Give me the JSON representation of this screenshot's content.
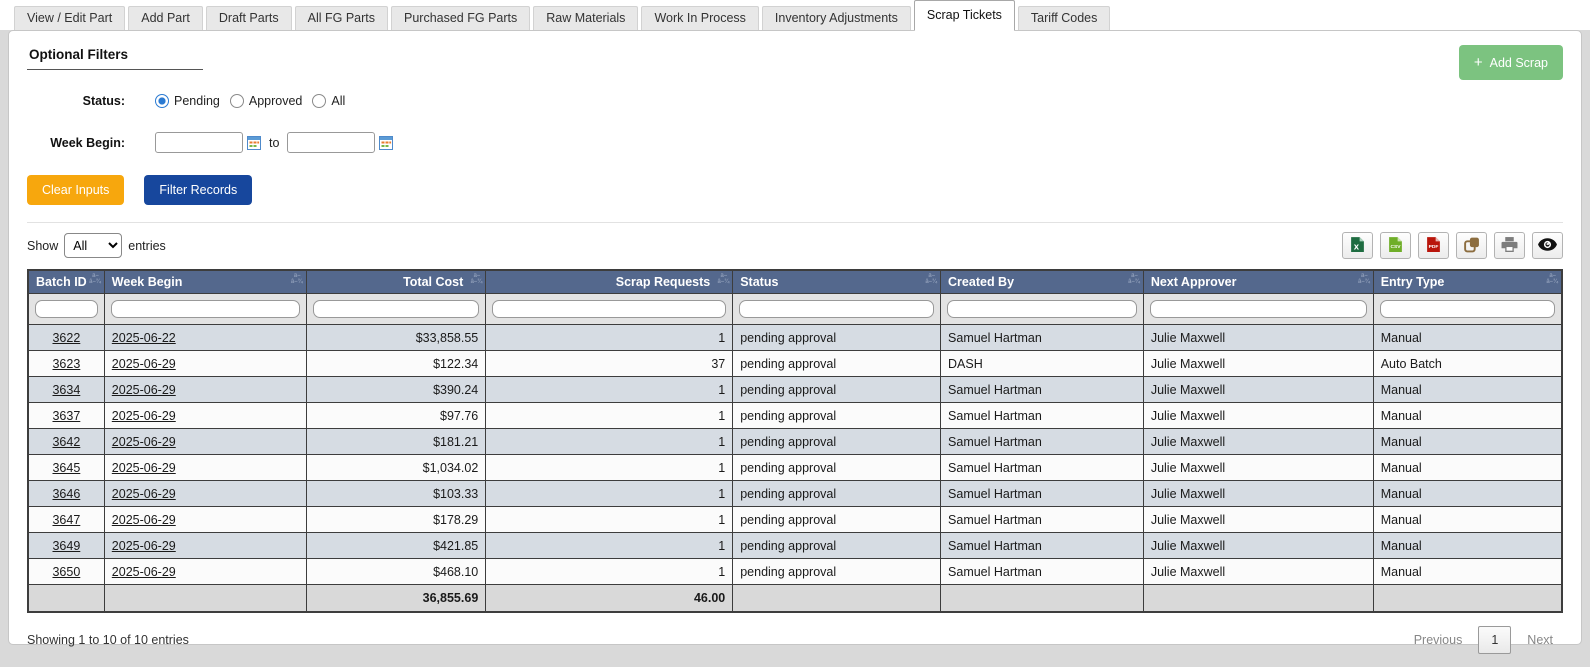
{
  "tabs": {
    "items": [
      {
        "label": "View / Edit Part",
        "active": false
      },
      {
        "label": "Add Part",
        "active": false
      },
      {
        "label": "Draft Parts",
        "active": false
      },
      {
        "label": "All FG Parts",
        "active": false
      },
      {
        "label": "Purchased FG Parts",
        "active": false
      },
      {
        "label": "Raw Materials",
        "active": false
      },
      {
        "label": "Work In Process",
        "active": false
      },
      {
        "label": "Inventory Adjustments",
        "active": false
      },
      {
        "label": "Scrap Tickets",
        "active": true
      },
      {
        "label": "Tariff Codes",
        "active": false
      }
    ]
  },
  "filters": {
    "title": "Optional Filters",
    "status_label": "Status:",
    "status_options": [
      {
        "label": "Pending",
        "selected": true
      },
      {
        "label": "Approved",
        "selected": false
      },
      {
        "label": "All",
        "selected": false
      }
    ],
    "week_begin_label": "Week Begin:",
    "week_from_value": "",
    "week_to_value": "",
    "range_separator": "to",
    "clear_button": "Clear Inputs",
    "filter_button": "Filter Records"
  },
  "actions": {
    "add_scrap_icon": "+",
    "add_scrap_label": "Add Scrap"
  },
  "toolbar": {
    "show_label": "Show",
    "entries_label": "entries",
    "page_length_selected": "All",
    "export_buttons": [
      "excel",
      "csv",
      "pdf",
      "copy",
      "print",
      "column-visibility"
    ]
  },
  "table": {
    "sort_icon": {
      "line1": "â–´",
      "line2": "â–¾"
    },
    "columns": [
      {
        "label": "Batch ID",
        "head_align": "left",
        "body_align": "center",
        "link": true
      },
      {
        "label": "Week Begin",
        "head_align": "left",
        "body_align": "left",
        "link": true
      },
      {
        "label": "Total Cost",
        "head_align": "right",
        "body_align": "right",
        "link": false
      },
      {
        "label": "Scrap Requests",
        "head_align": "right",
        "body_align": "right",
        "link": false
      },
      {
        "label": "Status",
        "head_align": "left",
        "body_align": "left",
        "link": false
      },
      {
        "label": "Created By",
        "head_align": "left",
        "body_align": "left",
        "link": false
      },
      {
        "label": "Next Approver",
        "head_align": "left",
        "body_align": "left",
        "link": false
      },
      {
        "label": "Entry Type",
        "head_align": "left",
        "body_align": "left",
        "link": false
      }
    ],
    "filter_values": [
      "",
      "",
      "",
      "",
      "",
      "",
      "",
      ""
    ],
    "rows": [
      [
        "3622",
        "2025-06-22",
        "$33,858.55",
        "1",
        "pending approval",
        "Samuel Hartman",
        "Julie Maxwell",
        "Manual"
      ],
      [
        "3623",
        "2025-06-29",
        "$122.34",
        "37",
        "pending approval",
        "DASH",
        "Julie Maxwell",
        "Auto Batch"
      ],
      [
        "3634",
        "2025-06-29",
        "$390.24",
        "1",
        "pending approval",
        "Samuel Hartman",
        "Julie Maxwell",
        "Manual"
      ],
      [
        "3637",
        "2025-06-29",
        "$97.76",
        "1",
        "pending approval",
        "Samuel Hartman",
        "Julie Maxwell",
        "Manual"
      ],
      [
        "3642",
        "2025-06-29",
        "$181.21",
        "1",
        "pending approval",
        "Samuel Hartman",
        "Julie Maxwell",
        "Manual"
      ],
      [
        "3645",
        "2025-06-29",
        "$1,034.02",
        "1",
        "pending approval",
        "Samuel Hartman",
        "Julie Maxwell",
        "Manual"
      ],
      [
        "3646",
        "2025-06-29",
        "$103.33",
        "1",
        "pending approval",
        "Samuel Hartman",
        "Julie Maxwell",
        "Manual"
      ],
      [
        "3647",
        "2025-06-29",
        "$178.29",
        "1",
        "pending approval",
        "Samuel Hartman",
        "Julie Maxwell",
        "Manual"
      ],
      [
        "3649",
        "2025-06-29",
        "$421.85",
        "1",
        "pending approval",
        "Samuel Hartman",
        "Julie Maxwell",
        "Manual"
      ],
      [
        "3650",
        "2025-06-29",
        "$468.10",
        "1",
        "pending approval",
        "Samuel Hartman",
        "Julie Maxwell",
        "Manual"
      ]
    ],
    "footer": [
      "",
      "",
      "36,855.69",
      "46.00",
      "",
      "",
      "",
      ""
    ]
  },
  "pagination": {
    "summary": "Showing 1 to 10 of 10 entries",
    "previous": "Previous",
    "current_page": "1",
    "next": "Next"
  },
  "colors": {
    "add_scrap_green": "#7CC380",
    "clear_orange": "#F7A70D",
    "filter_blue": "#17479D",
    "table_header_blue": "#54688D",
    "row_alt_blue_gray": "#D6DCE3",
    "footer_gray": "#D9D9D9",
    "radio_blue": "#2A7AD2",
    "excel_green": "#1E6C41",
    "csv_green": "#6FAE28",
    "pdf_red": "#B9150B",
    "copy_brown": "#8C6D3F",
    "print_gray": "#7D7D7D",
    "eye_black": "#111111"
  }
}
